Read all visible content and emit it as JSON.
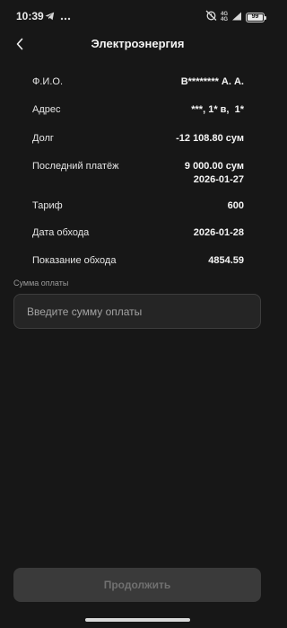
{
  "status_bar": {
    "time": "10:39",
    "network": {
      "top": "4G",
      "bottom": "4G"
    },
    "battery": "99",
    "battery_level": 0.99,
    "icons": [
      "telegram-icon",
      "more-dots-icon",
      "alarm-off-icon",
      "signal-icon",
      "battery-icon"
    ]
  },
  "header": {
    "title": "Электроэнергия",
    "back_icon": "chevron-left-icon"
  },
  "details": [
    {
      "label": "Ф.И.О.",
      "value": "B******** А. А."
    },
    {
      "label": "Адрес",
      "value": "***, 1* в,  1*"
    },
    {
      "label": "Долг",
      "value": "-12 108.80 сум"
    },
    {
      "label": "Последний платёж",
      "value": "9 000.00 сум\n2026-01-27"
    },
    {
      "label": "Тариф",
      "value": "600"
    },
    {
      "label": "Дата обхода",
      "value": "2026-01-28"
    },
    {
      "label": "Показание обхода",
      "value": "4854.59"
    }
  ],
  "payment": {
    "label": "Сумма оплаты",
    "placeholder": "Введите сумму оплаты",
    "value": ""
  },
  "actions": {
    "continue_label": "Продолжить"
  },
  "colors": {
    "background": "#171717",
    "input_background": "#252525",
    "button_disabled": "#3a3a3a",
    "button_text_disabled": "#707070"
  }
}
